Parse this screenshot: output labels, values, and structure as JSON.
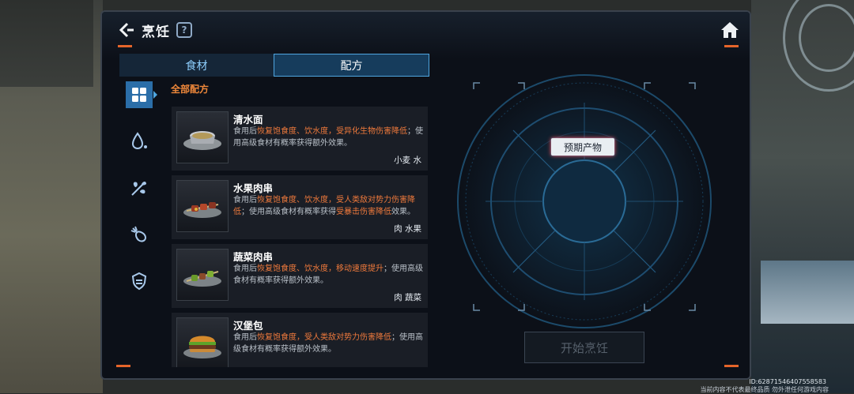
{
  "header": {
    "title": "烹饪",
    "help_label": "?"
  },
  "tabs": [
    {
      "label": "食材",
      "active": false
    },
    {
      "label": "配方",
      "active": true
    }
  ],
  "category": {
    "label": "全部配方"
  },
  "side_icons": [
    "all-recipes-icon",
    "water-drop-icon",
    "herb-icon",
    "meat-icon",
    "shield-food-icon"
  ],
  "recipes": [
    {
      "name": "清水面",
      "desc_parts": [
        {
          "t": "食用后",
          "hl": false
        },
        {
          "t": "恢复饱食度、饮水度，受异化生物伤害降低",
          "hl": true
        },
        {
          "t": "；使用高级食材有概率获得额外效果。",
          "hl": false
        }
      ],
      "ingredients": "小麦 水"
    },
    {
      "name": "水果肉串",
      "desc_parts": [
        {
          "t": "食用后",
          "hl": false
        },
        {
          "t": "恢复饱食度、饮水度，受人类敌对势力伤害降低",
          "hl": true
        },
        {
          "t": "；使用高级食材有概率获得",
          "hl": false
        },
        {
          "t": "受暴击伤害降低",
          "hl": true
        },
        {
          "t": "效果。",
          "hl": false
        }
      ],
      "ingredients": "肉 水果"
    },
    {
      "name": "蔬菜肉串",
      "desc_parts": [
        {
          "t": "食用后",
          "hl": false
        },
        {
          "t": "恢复饱食度、饮水度，移动速度提升",
          "hl": true
        },
        {
          "t": "；使用高级食材有概率获得额外效果。",
          "hl": false
        }
      ],
      "ingredients": "肉 蔬菜"
    },
    {
      "name": "汉堡包",
      "desc_parts": [
        {
          "t": "食用后",
          "hl": false
        },
        {
          "t": "恢复饱食度，受人类敌对势力伤害降低",
          "hl": true
        },
        {
          "t": "；使用高级食材有概率获得额外效果。",
          "hl": false
        }
      ],
      "ingredients": ""
    }
  ],
  "product_label": "预期产物",
  "start_button": "开始烹饪",
  "footer": {
    "id_text": "ID:62871546407558583",
    "note": "当前内容不代表最终品质  勿外泄任何游戏内容"
  },
  "colors": {
    "accent_orange": "#e5652a",
    "highlight": "#f07a3c",
    "tab_active": "#163c5c"
  }
}
